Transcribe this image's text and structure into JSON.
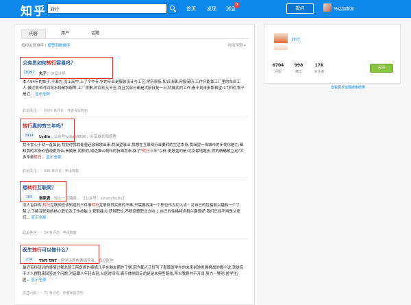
{
  "header": {
    "logo": "知乎",
    "search_value": "转行",
    "nav": [
      "首页",
      "发现",
      "消息"
    ],
    "message_badge": "9",
    "ask_label": "提问",
    "username": "马达加斯加"
  },
  "tabs": [
    "内容",
    "用户",
    "话题"
  ],
  "sort": {
    "prefix": "按相关度排序",
    "divider": " | ",
    "alt": "按赞同数排序",
    "time": "时间不限 ▾"
  },
  "results": [
    {
      "title_pre": "公务员如何",
      "title_hl": "转行",
      "title_post": "容易吗？",
      "votes": "28297",
      "author": "丸子",
      "author_meta": "，UI设计师",
      "body": "本人94年的妹子,平面方,没上高中,上了个中专,学的专业是服装设计与工艺,学历很低,知识浅薄,网投简历,工作只能靠工厂里的车间工人,做过很长时间流水线散衣服等,工厂很累,时间长又辛苦,而且大部分都是大厨日复一日,机械式的工作,看不到未来那希望!17岁时,鲁子是近...",
      "more": "显示全部",
      "foot": "取消关注 | ♡ 4509 条评论 · 作者保留权利"
    },
    {
      "title_pre": "",
      "title_hl": "转行",
      "title_post": "真的穷三年吗？",
      "votes": "3914",
      "author": "Lydia",
      "author_meta": "，公众号lydia66890，分享成长和感悟",
      "body": "我不甘心于就一直如此,我觉得我的能量还会释放出来,我渴望事业,我想在互联网行业要转的生活本身,我渴望一线城市的步伐化魅力,都和我的本身价值观更符合,贵贼份,同样的,周边推山啊吗的折面而来,除了\"",
      "body_hl": "转行",
      "body2": "三年\"以外,更好金的是:北京最地踞天,你的精确故立足?大多不敢",
      "body_hl2": "转行",
      "body3": "...",
      "more": "显示全部",
      "foot": "取消关注 | ♡ 330 条评论 · 申请转载"
    },
    {
      "title_pre": "想",
      "title_hl": "转行",
      "title_post": "互联网？",
      "votes": "205",
      "author": "谢家君",
      "author_meta": "，知心一页路务... 【公众号：xinanchu01】",
      "body": "没人吉祥你,",
      "body_hl": "转行",
      "body2": "互联网应该知道的三件事",
      "body_hl2": "转行",
      "body3": "互联网其实真的不难,只需要找准一个职位作为切入点！对自己的性格和兴趣有一个了解,2.了解互联网的核心职位及工作技能,3.获取能力,获得职位,不断调整职业方向.1.自己的性格特点和兴趣爱好:我们已经不再是父辈们...",
      "more": "显示全部",
      "foot": "取消关注 | ♡ 34 条评论 · 申请转载"
    },
    {
      "title_pre": "医生",
      "title_hl": "转行",
      "title_post": "可以做什么？",
      "votes": "274",
      "author": "TNT TNT",
      "author_meta": "，医学话题优秀回答者，我过医生",
      "body": "最近有科研训的事情过我北医三院医闹的事情几乎在朋友圈炸了锅,因为都人正好写了那篇医学生的未来前途发展挑战的微小说,就是有不少人摆我来回答这个问题.对话跟人年轻去轻,从医时间吗,离开体制后走的是是未典型路线,所以我野并不开阔,努力一警吧,医学生/医...",
      "more": "显示全部",
      "foot": "关注问题 | ♡ 71 条评论 · 作者保留权利"
    }
  ],
  "sidebar": {
    "topic": "转行",
    "stats": [
      {
        "value": "6704",
        "label": "问题"
      },
      {
        "value": "998",
        "label": "精华"
      },
      {
        "value": "17K",
        "label": "关注者"
      }
    ],
    "follow_label": "关注",
    "link": "查看更多话题搜索结果"
  }
}
